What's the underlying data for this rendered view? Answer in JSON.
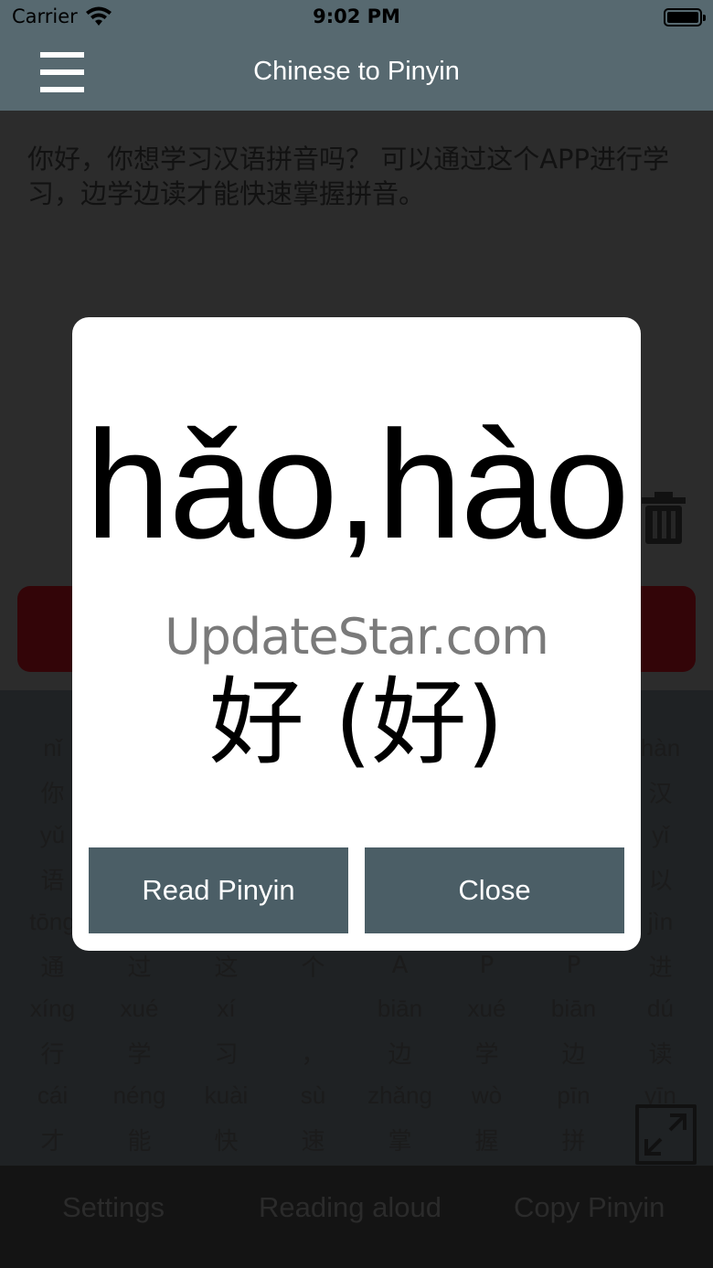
{
  "status_bar": {
    "carrier": "Carrier",
    "time": "9:02 PM"
  },
  "nav": {
    "title": "Chinese to Pinyin",
    "menu_icon": "hamburger-menu-icon"
  },
  "input_text": "你好，你想学习汉语拼音吗？ 可以通过这个APP进行学习，边学边读才能快速掌握拼音。",
  "grid": [
    [
      "nǐ",
      "",
      "",
      "",
      "",
      "",
      "",
      "hàn"
    ],
    [
      "你",
      "",
      "",
      "",
      "",
      "",
      "",
      "汉"
    ],
    [
      "yǔ",
      "",
      "",
      "",
      "",
      "",
      "",
      "yǐ"
    ],
    [
      "语",
      "",
      "",
      "",
      "",
      "",
      "",
      "以"
    ],
    [
      "tōng",
      "",
      "",
      "",
      "",
      "",
      "",
      "jìn"
    ],
    [
      "通",
      "过",
      "这",
      "个",
      "A",
      "P",
      "P",
      "进"
    ],
    [
      "xíng",
      "xué",
      "xí",
      "",
      "biān",
      "xué",
      "biān",
      "dú"
    ],
    [
      "行",
      "学",
      "习",
      "，",
      "边",
      "学",
      "边",
      "读"
    ],
    [
      "cái",
      "néng",
      "kuài",
      "sù",
      "zhǎng",
      "wò",
      "pīn",
      "yīn"
    ],
    [
      "才",
      "能",
      "快",
      "速",
      "掌",
      "握",
      "拼",
      ""
    ]
  ],
  "tabs": {
    "settings": "Settings",
    "reading": "Reading aloud",
    "copy": "Copy Pinyin"
  },
  "dialog": {
    "pinyin": "hǎo,hào",
    "watermark": "UpdateStar.com",
    "hanzi": "好 (好)",
    "read_button": "Read Pinyin",
    "close_button": "Close"
  },
  "colors": {
    "header": "#576970",
    "button": "#4b5e66",
    "accent_red": "#330508"
  }
}
